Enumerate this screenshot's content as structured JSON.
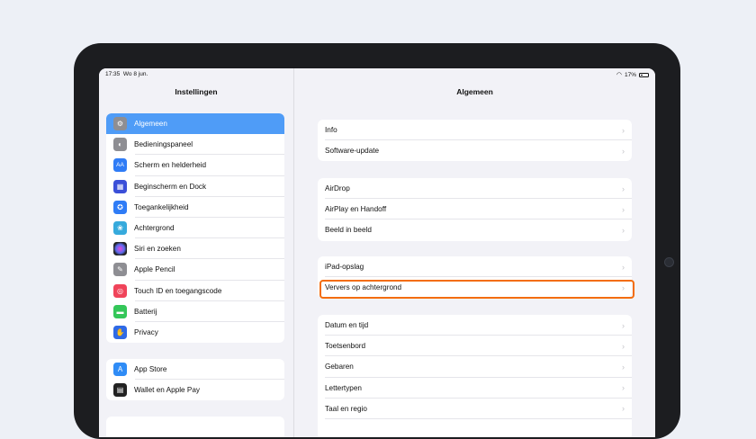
{
  "status_bar": {
    "time": "17:35",
    "date": "Wo 8 jun.",
    "battery": "17%"
  },
  "sidebar": {
    "title": "Instellingen",
    "groups": [
      {
        "items": [
          {
            "label": "Algemeen",
            "icon": "gear-icon",
            "color": "#8e8e93",
            "selected": true
          },
          {
            "label": "Bedieningspaneel",
            "icon": "control-center-icon",
            "color": "#8e8e93"
          },
          {
            "label": "Scherm en helderheid",
            "icon": "display-icon",
            "color": "#2f7cf6"
          },
          {
            "label": "Beginscherm en Dock",
            "icon": "home-screen-icon",
            "color": "#3b4fd8"
          },
          {
            "label": "Toegankelijkheid",
            "icon": "accessibility-icon",
            "color": "#2f7cf6"
          },
          {
            "label": "Achtergrond",
            "icon": "wallpaper-icon",
            "color": "#36aadc"
          },
          {
            "label": "Siri en zoeken",
            "icon": "siri-icon",
            "color": "#222222"
          },
          {
            "label": "Apple Pencil",
            "icon": "pencil-icon",
            "color": "#8e8e93"
          },
          {
            "label": "Touch ID en toegangscode",
            "icon": "fingerprint-icon",
            "color": "#f0445a"
          },
          {
            "label": "Batterij",
            "icon": "battery-icon",
            "color": "#34c759"
          },
          {
            "label": "Privacy",
            "icon": "hand-icon",
            "color": "#2f6ae6"
          }
        ]
      },
      {
        "items": [
          {
            "label": "App Store",
            "icon": "app-store-icon",
            "color": "#2f8cf6"
          },
          {
            "label": "Wallet en Apple Pay",
            "icon": "wallet-icon",
            "color": "#222222"
          }
        ]
      }
    ]
  },
  "main": {
    "title": "Algemeen",
    "groups": [
      {
        "items": [
          "Info",
          "Software-update"
        ]
      },
      {
        "items": [
          "AirDrop",
          "AirPlay en Handoff",
          "Beeld in beeld"
        ]
      },
      {
        "items": [
          "iPad-opslag",
          "Ververs op achtergrond"
        ]
      },
      {
        "items": [
          "Datum en tijd",
          "Toetsenbord",
          "Gebaren",
          "Lettertypen",
          "Taal en regio"
        ]
      }
    ]
  },
  "highlight": {
    "color": "#f36d0e",
    "target": "Ververs op achtergrond"
  }
}
